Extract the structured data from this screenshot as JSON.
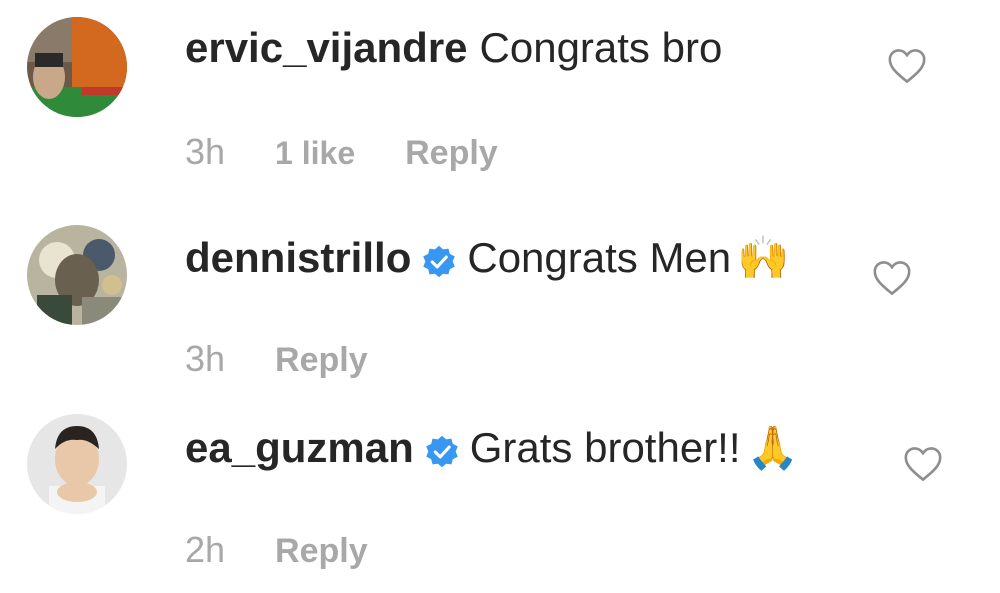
{
  "comments": [
    {
      "username": "ervic_vijandre",
      "verified": false,
      "text": "Congrats bro",
      "emoji": "",
      "time": "3h",
      "likes": "1 like",
      "reply": "Reply"
    },
    {
      "username": "dennistrillo",
      "verified": true,
      "text": "Congrats Men",
      "emoji": "🙌",
      "time": "3h",
      "likes": "",
      "reply": "Reply"
    },
    {
      "username": "ea_guzman",
      "verified": true,
      "text": "Grats brother!! ",
      "emoji": "🙏",
      "time": "2h",
      "likes": "",
      "reply": "Reply"
    }
  ],
  "colors": {
    "text": "#262626",
    "muted": "#a8a8a8",
    "verified": "#3897f0",
    "heart_stroke": "#8e8e8e"
  },
  "icons": {
    "like": "heart-outline-icon",
    "verified": "verified-badge-icon"
  }
}
